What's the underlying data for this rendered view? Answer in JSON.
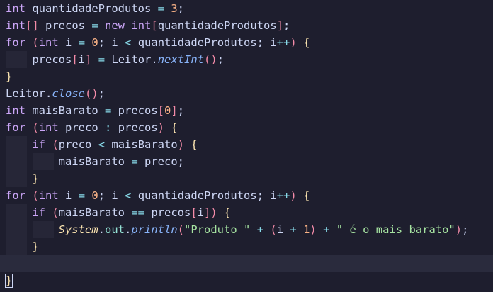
{
  "editor": {
    "lines": [
      [
        [
          "kw",
          "int"
        ],
        [
          "txt",
          " quantidadeProdutos "
        ],
        [
          "op",
          "="
        ],
        [
          "txt",
          " "
        ],
        [
          "num",
          "3"
        ],
        [
          "txt",
          ";"
        ]
      ],
      [
        [
          "kw",
          "int"
        ],
        [
          "brk",
          "[]"
        ],
        [
          "txt",
          " precos "
        ],
        [
          "op",
          "="
        ],
        [
          "txt",
          " "
        ],
        [
          "kw",
          "new"
        ],
        [
          "txt",
          " "
        ],
        [
          "kw",
          "int"
        ],
        [
          "brk",
          "["
        ],
        [
          "txt",
          "quantidadeProdutos"
        ],
        [
          "brk",
          "]"
        ],
        [
          "txt",
          ";"
        ]
      ],
      [
        [
          "kw",
          "for"
        ],
        [
          "txt",
          " "
        ],
        [
          "brk",
          "("
        ],
        [
          "kw",
          "int"
        ],
        [
          "txt",
          " i "
        ],
        [
          "op",
          "="
        ],
        [
          "txt",
          " "
        ],
        [
          "num",
          "0"
        ],
        [
          "txt",
          "; i "
        ],
        [
          "op",
          "<"
        ],
        [
          "txt",
          " quantidadeProdutos; i"
        ],
        [
          "op",
          "++"
        ],
        [
          "brk",
          ")"
        ],
        [
          "txt",
          " "
        ],
        [
          "brk2",
          "{"
        ]
      ],
      [
        [
          "txt",
          "    precos"
        ],
        [
          "brk",
          "["
        ],
        [
          "txt",
          "i"
        ],
        [
          "brk",
          "]"
        ],
        [
          "txt",
          " "
        ],
        [
          "op",
          "="
        ],
        [
          "txt",
          " Leitor."
        ],
        [
          "fn",
          "nextInt"
        ],
        [
          "brk",
          "()"
        ],
        [
          "txt",
          ";"
        ]
      ],
      [
        [
          "brk2",
          "}"
        ]
      ],
      [
        [
          "txt",
          "Leitor."
        ],
        [
          "fn",
          "close"
        ],
        [
          "brk",
          "()"
        ],
        [
          "txt",
          ";"
        ]
      ],
      [
        [
          "kw",
          "int"
        ],
        [
          "txt",
          " maisBarato "
        ],
        [
          "op",
          "="
        ],
        [
          "txt",
          " precos"
        ],
        [
          "brk",
          "["
        ],
        [
          "num",
          "0"
        ],
        [
          "brk",
          "]"
        ],
        [
          "txt",
          ";"
        ]
      ],
      [
        [
          "kw",
          "for"
        ],
        [
          "txt",
          " "
        ],
        [
          "brk",
          "("
        ],
        [
          "kw",
          "int"
        ],
        [
          "txt",
          " preco "
        ],
        [
          "op",
          ":"
        ],
        [
          "txt",
          " precos"
        ],
        [
          "brk",
          ")"
        ],
        [
          "txt",
          " "
        ],
        [
          "brk2",
          "{"
        ]
      ],
      [
        [
          "txt",
          "    "
        ],
        [
          "kw",
          "if"
        ],
        [
          "txt",
          " "
        ],
        [
          "brk",
          "("
        ],
        [
          "txt",
          "preco "
        ],
        [
          "op",
          "<"
        ],
        [
          "txt",
          " maisBarato"
        ],
        [
          "brk",
          ")"
        ],
        [
          "txt",
          " "
        ],
        [
          "brk2",
          "{"
        ]
      ],
      [
        [
          "txt",
          "        maisBarato "
        ],
        [
          "op",
          "="
        ],
        [
          "txt",
          " preco;"
        ]
      ],
      [
        [
          "txt",
          "    "
        ],
        [
          "brk2",
          "}"
        ]
      ],
      [
        [
          "kw",
          "for"
        ],
        [
          "txt",
          " "
        ],
        [
          "brk",
          "("
        ],
        [
          "kw",
          "int"
        ],
        [
          "txt",
          " i "
        ],
        [
          "op",
          "="
        ],
        [
          "txt",
          " "
        ],
        [
          "num",
          "0"
        ],
        [
          "txt",
          "; i "
        ],
        [
          "op",
          "<"
        ],
        [
          "txt",
          " quantidadeProdutos; i"
        ],
        [
          "op",
          "++"
        ],
        [
          "brk",
          ")"
        ],
        [
          "txt",
          " "
        ],
        [
          "brk2",
          "{"
        ]
      ],
      [
        [
          "txt",
          "    "
        ],
        [
          "kw",
          "if"
        ],
        [
          "txt",
          " "
        ],
        [
          "brk",
          "("
        ],
        [
          "txt",
          "maisBarato "
        ],
        [
          "op",
          "=="
        ],
        [
          "txt",
          " precos"
        ],
        [
          "brk",
          "["
        ],
        [
          "txt",
          "i"
        ],
        [
          "brk",
          "]"
        ],
        [
          "brk",
          ")"
        ],
        [
          "txt",
          " "
        ],
        [
          "brk2",
          "{"
        ]
      ],
      [
        [
          "txt",
          "        "
        ],
        [
          "cls",
          "System"
        ],
        [
          "txt",
          "."
        ],
        [
          "fld",
          "out"
        ],
        [
          "txt",
          "."
        ],
        [
          "fn",
          "println"
        ],
        [
          "brk",
          "("
        ],
        [
          "str",
          "\"Produto \""
        ],
        [
          "txt",
          " "
        ],
        [
          "op",
          "+"
        ],
        [
          "txt",
          " "
        ],
        [
          "brk",
          "("
        ],
        [
          "txt",
          "i "
        ],
        [
          "op",
          "+"
        ],
        [
          "txt",
          " "
        ],
        [
          "num",
          "1"
        ],
        [
          "brk",
          ")"
        ],
        [
          "txt",
          " "
        ],
        [
          "op",
          "+"
        ],
        [
          "txt",
          " "
        ],
        [
          "str",
          "\" é o mais barato\""
        ],
        [
          "brk",
          ")"
        ],
        [
          "txt",
          ";"
        ]
      ],
      [
        [
          "txt",
          "    "
        ],
        [
          "brk2",
          "}"
        ]
      ],
      [],
      [
        [
          "brk2",
          "}"
        ]
      ]
    ]
  },
  "colors": {
    "background": "#1e1e2e",
    "current_line": "#2a2b3d",
    "keyword": "#cba6f7",
    "number": "#fab387",
    "string": "#a6e3a1"
  }
}
